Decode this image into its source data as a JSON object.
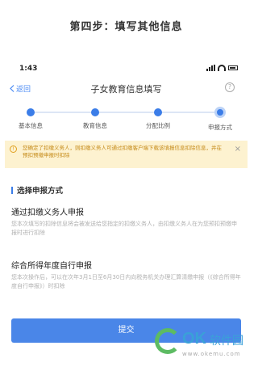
{
  "step_heading": "第四步：填写其他信息",
  "status_bar": {
    "time": "1:43"
  },
  "nav": {
    "back_label": "返回",
    "title": "子女教育信息填写",
    "help_glyph": "?"
  },
  "steps": [
    {
      "label": "基本信息"
    },
    {
      "label": "教育信息"
    },
    {
      "label": "分配比例"
    },
    {
      "label": "申报方式",
      "active": true
    }
  ],
  "notice": {
    "icon_glyph": "!",
    "text": "您确定了扣缴义务人，则扣缴义务人可通过扣缴客户端下载该填报信息扣除信息，并在预扣预缴申报时扣除",
    "close_glyph": "×"
  },
  "section_title": "选择申报方式",
  "options": [
    {
      "title": "通过扣缴义务人申报",
      "desc": "您本次填写的扣除信息将会被发送给您指定的扣缴义务人，由扣缴义务人在为您预扣预缴申报时进行扣除"
    },
    {
      "title": "综合所得年度自行申报",
      "desc": "您本次操作后，可以在次年3月1日至6月30日内向税务机关办理汇算清缴申报（《综合所得年度自行申报》）时扣除"
    }
  ],
  "submit_label": "提交",
  "watermark": {
    "brand": "OK",
    "cn": "软件园",
    "url": "www.okemu.com"
  }
}
